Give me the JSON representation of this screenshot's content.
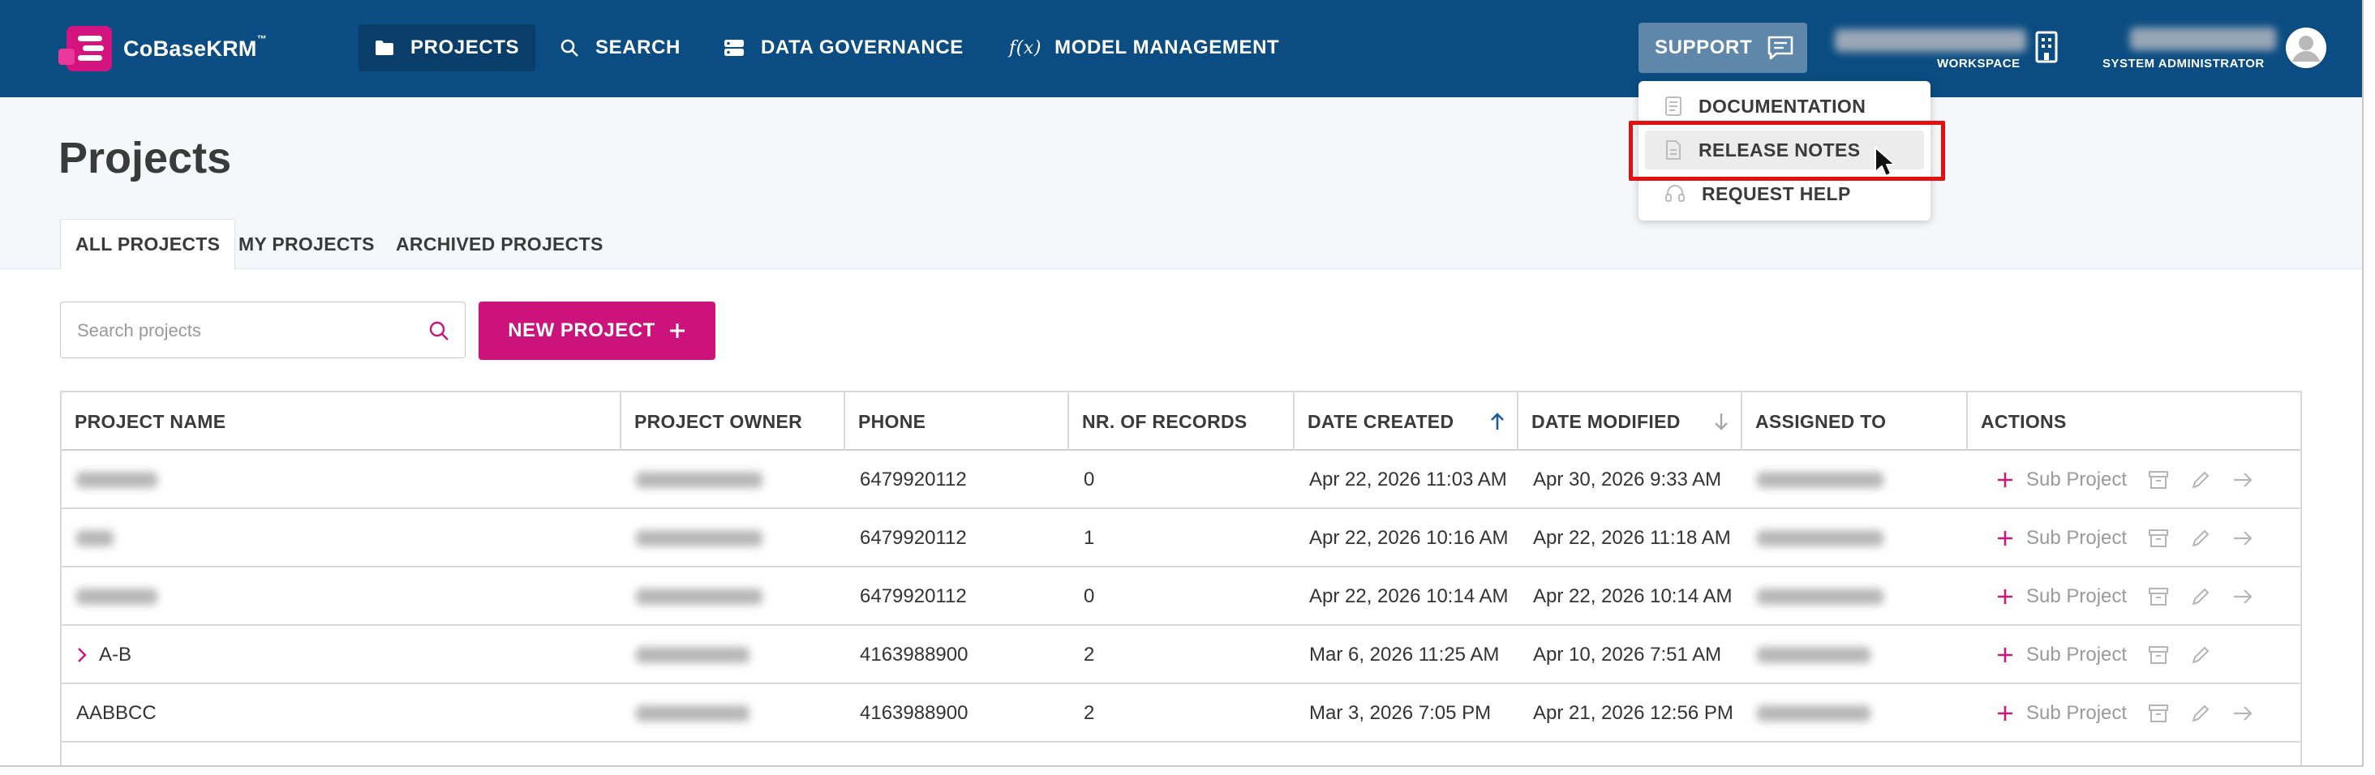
{
  "app": {
    "brand": "CoBaseKRM",
    "trademark": "™"
  },
  "nav": {
    "items": [
      {
        "label": "PROJECTS",
        "icon": "folder-icon",
        "active": true
      },
      {
        "label": "SEARCH",
        "icon": "search-icon",
        "active": false
      },
      {
        "label": "DATA GOVERNANCE",
        "icon": "database-icon",
        "active": false
      },
      {
        "label": "MODEL MANAGEMENT",
        "icon": "function-icon",
        "active": false
      }
    ],
    "function_icon_text": "f(x)",
    "support_label": "SUPPORT",
    "workspace_label": "WORKSPACE",
    "admin_label": "SYSTEM ADMINISTRATOR"
  },
  "support_menu": {
    "items": [
      {
        "label": "DOCUMENTATION",
        "icon": "book-icon"
      },
      {
        "label": "RELEASE NOTES",
        "icon": "document-icon",
        "hovered": true
      },
      {
        "label": "REQUEST HELP",
        "icon": "headset-icon"
      }
    ]
  },
  "page": {
    "title": "Projects",
    "tabs": [
      {
        "label": "ALL PROJECTS",
        "active": true
      },
      {
        "label": "MY PROJECTS",
        "active": false
      },
      {
        "label": "ARCHIVED PROJECTS",
        "active": false
      }
    ]
  },
  "toolbar": {
    "search_placeholder": "Search projects",
    "new_project_label": "NEW PROJECT"
  },
  "table": {
    "columns": [
      "PROJECT NAME",
      "PROJECT OWNER",
      "PHONE",
      "NR. OF RECORDS",
      "DATE CREATED",
      "DATE MODIFIED",
      "ASSIGNED TO",
      "ACTIONS"
    ],
    "sort": {
      "column": "DATE CREATED",
      "direction": "ascending"
    },
    "sub_project_label": "Sub Project",
    "rows": [
      {
        "name": "",
        "name_blurred": true,
        "owner_blurred": true,
        "phone": "6479920112",
        "records": "0",
        "created": "Apr 22, 2026 11:03 AM",
        "modified": "Apr 30, 2026 9:33 AM",
        "expandable": false,
        "has_open": true
      },
      {
        "name": "",
        "name_blurred": true,
        "owner_blurred": true,
        "phone": "6479920112",
        "records": "1",
        "created": "Apr 22, 2026 10:16 AM",
        "modified": "Apr 22, 2026 11:18 AM",
        "expandable": false,
        "has_open": true
      },
      {
        "name": "",
        "name_blurred": true,
        "owner_blurred": true,
        "phone": "6479920112",
        "records": "0",
        "created": "Apr 22, 2026 10:14 AM",
        "modified": "Apr 22, 2026 10:14 AM",
        "expandable": false,
        "has_open": true
      },
      {
        "name": "A-B",
        "name_blurred": false,
        "owner_blurred": true,
        "phone": "4163988900",
        "records": "2",
        "created": "Mar 6, 2026 11:25 AM",
        "modified": "Apr 10, 2026 7:51 AM",
        "expandable": true,
        "has_open": false
      },
      {
        "name": "AABBCC",
        "name_blurred": false,
        "owner_blurred": true,
        "phone": "4163988900",
        "records": "2",
        "created": "Mar 3, 2026 7:05 PM",
        "modified": "Apr 21, 2026 12:56 PM",
        "expandable": false,
        "has_open": true
      }
    ]
  },
  "colors": {
    "nav_bg": "#0b4d82",
    "brand_pink": "#cc137b",
    "highlight_red": "#e21010"
  }
}
